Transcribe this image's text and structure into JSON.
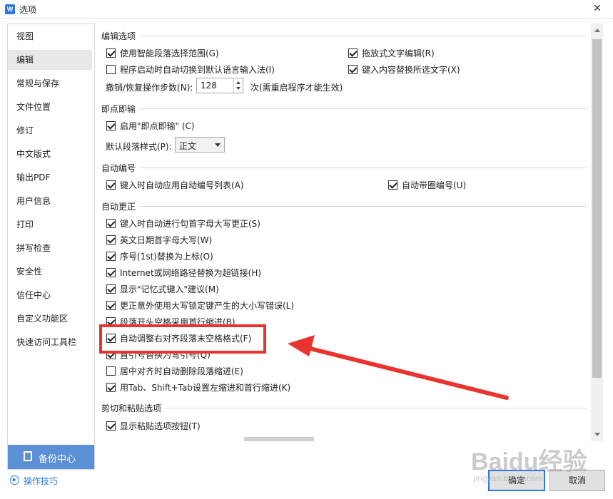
{
  "window": {
    "title": "选项",
    "app_icon": "W"
  },
  "sidebar": {
    "items": [
      {
        "label": "视图"
      },
      {
        "label": "编辑",
        "active": true
      },
      {
        "label": "常规与保存"
      },
      {
        "label": "文件位置"
      },
      {
        "label": "修订"
      },
      {
        "label": "中文版式"
      },
      {
        "label": "输出PDF"
      },
      {
        "label": "用户信息"
      },
      {
        "label": "打印"
      },
      {
        "label": "拼写检查"
      },
      {
        "label": "安全性"
      },
      {
        "label": "信任中心"
      },
      {
        "label": "自定义功能区"
      },
      {
        "label": "快速访问工具栏"
      }
    ],
    "backup_label": "备份中心",
    "tips_label": "操作技巧"
  },
  "sections": {
    "edit_options": {
      "title": "编辑选项",
      "smart_paragraph": {
        "label": "使用智能段落选择范围(G)",
        "checked": true
      },
      "drag_edit": {
        "label": "拖放式文字编辑(R)",
        "checked": true
      },
      "auto_ime": {
        "label": "程序启动时自动切换到默认语言输入法(I)",
        "checked": false
      },
      "replace_selection": {
        "label": "键入内容替换所选文字(X)",
        "checked": true
      },
      "undo_label": "撤销/恢复操作步数(N):",
      "undo_value": "128",
      "undo_note": "次(需重启程序才能生效)"
    },
    "click_type": {
      "title": "即点即输",
      "enable": {
        "label": "启用\"即点即输\" (C)",
        "checked": true
      },
      "default_style_label": "默认段落样式(P):",
      "default_style_value": "正文"
    },
    "auto_number": {
      "title": "自动编号",
      "auto_list": {
        "label": "键入时自动应用自动编号列表(A)",
        "checked": true
      },
      "circle_number": {
        "label": "自动带圈编号(U)",
        "checked": true
      }
    },
    "auto_correct": {
      "title": "自动更正",
      "items": [
        {
          "label": "键入时自动进行句首字母大写更正(S)",
          "checked": true
        },
        {
          "label": "英文日期首字母大写(W)",
          "checked": true
        },
        {
          "label": "序号(1st)替换为上标(O)",
          "checked": true
        },
        {
          "label": "Internet或网络路径替换为超链接(H)",
          "checked": true
        },
        {
          "label": "显示\"记忆式键入\"建议(M)",
          "checked": true
        },
        {
          "label": "更正意外使用大写锁定键产生的大小写错误(L)",
          "checked": true
        },
        {
          "label": "段落开头空格采用首行缩进(B)",
          "checked": true
        },
        {
          "label": "自动调整右对齐段落末空格格式(F)",
          "checked": true
        },
        {
          "label": "直引号替换为弯引号(Q)",
          "checked": true
        },
        {
          "label": "居中对齐时自动删除段落缩进(E)",
          "checked": false
        },
        {
          "label": "用Tab、Shift+Tab设置左缩进和首行缩进(K)",
          "checked": true
        }
      ]
    },
    "paste": {
      "title": "剪切和粘贴选项",
      "show_paste_btn": {
        "label": "显示粘贴选项按钮(T)",
        "checked": true
      }
    }
  },
  "footer": {
    "ok_label": "确定",
    "cancel_label": "取消"
  },
  "watermark": {
    "brand": "Baidu经验",
    "url": "jingyan.baidu.com"
  },
  "colors": {
    "accent": "#2b78e4",
    "backup_bg": "#5b8fd6",
    "highlight": "#e8332e"
  }
}
